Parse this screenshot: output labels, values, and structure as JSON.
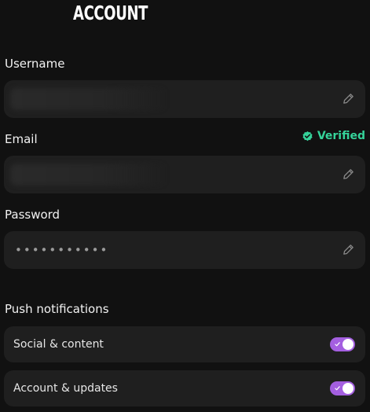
{
  "page": {
    "title": "ACCOUNT"
  },
  "username": {
    "label": "Username",
    "value": "",
    "edit_icon": "pencil-icon"
  },
  "email": {
    "label": "Email",
    "value": "",
    "status": "Verified",
    "status_icon": "check-circle-icon",
    "status_color": "#35d39a",
    "edit_icon": "pencil-icon"
  },
  "password": {
    "label": "Password",
    "value": "•••••••••••",
    "edit_icon": "pencil-icon"
  },
  "notifications": {
    "heading": "Push notifications",
    "items": [
      {
        "label": "Social & content",
        "enabled": true
      },
      {
        "label": "Account & updates",
        "enabled": true
      }
    ],
    "toggle_color": "#a45fe0"
  }
}
